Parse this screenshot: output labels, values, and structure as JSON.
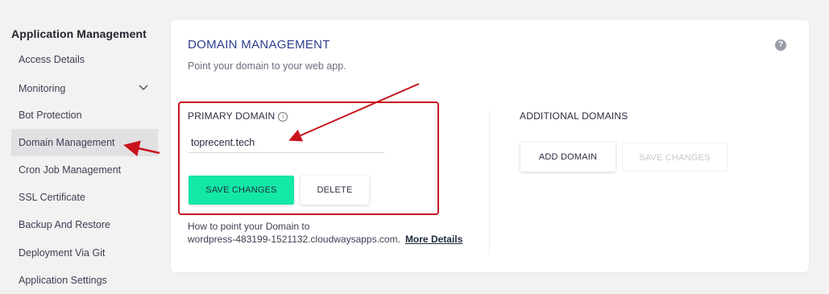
{
  "sidebar": {
    "heading": "Application Management",
    "items": [
      {
        "label": "Access Details"
      },
      {
        "label": "Monitoring"
      },
      {
        "label": "Bot Protection"
      },
      {
        "label": "Domain Management"
      },
      {
        "label": "Cron Job Management"
      },
      {
        "label": "SSL Certificate"
      },
      {
        "label": "Backup And Restore"
      },
      {
        "label": "Deployment Via Git"
      },
      {
        "label": "Application Settings"
      }
    ],
    "active_item": "Domain Management"
  },
  "card": {
    "title": "DOMAIN MANAGEMENT",
    "subtitle": "Point your domain to your web app.",
    "help_icon": "?"
  },
  "primary": {
    "label": "PRIMARY DOMAIN",
    "info_icon": "i",
    "domain_value": "toprecent.tech",
    "save_label": "SAVE CHANGES",
    "delete_label": "DELETE"
  },
  "howto": {
    "text_line1": "How to point your Domain to",
    "text_line2": "wordpress-483199-1521132.cloudwaysapps.com.",
    "link_label": "More Details"
  },
  "additional": {
    "label": "ADDITIONAL DOMAINS",
    "add_label": "ADD DOMAIN",
    "save_label": "SAVE CHANGES"
  },
  "colors": {
    "accent_green": "#14e8a7",
    "title_blue": "#2c3e8f",
    "annotation_red": "#c8151d",
    "active_bg": "#e1e1e4"
  }
}
